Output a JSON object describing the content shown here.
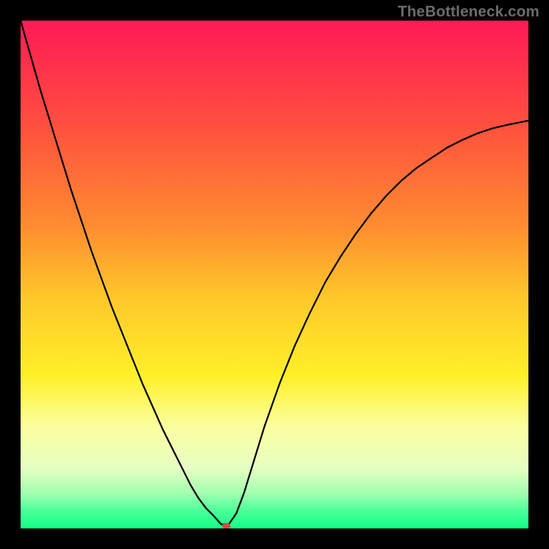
{
  "watermark": "TheBottleneck.com",
  "chart_data": {
    "type": "line",
    "title": "",
    "xlabel": "",
    "ylabel": "",
    "xlim": [
      0,
      100
    ],
    "ylim": [
      0,
      100
    ],
    "grid": false,
    "background": {
      "type": "vertical-gradient",
      "stops": [
        {
          "pos": 0.0,
          "color": "#ff1a55"
        },
        {
          "pos": 0.2,
          "color": "#ff4e3f"
        },
        {
          "pos": 0.4,
          "color": "#ff8b30"
        },
        {
          "pos": 0.55,
          "color": "#ffc92a"
        },
        {
          "pos": 0.7,
          "color": "#fff029"
        },
        {
          "pos": 0.8,
          "color": "#fbffa0"
        },
        {
          "pos": 0.88,
          "color": "#e7ffc2"
        },
        {
          "pos": 0.93,
          "color": "#a4ffb0"
        },
        {
          "pos": 0.965,
          "color": "#4cff9a"
        },
        {
          "pos": 1.0,
          "color": "#12ff86"
        }
      ]
    },
    "series": [
      {
        "name": "bottleneck-curve",
        "color": "#000000",
        "x": [
          0,
          2,
          4,
          6,
          8,
          10,
          12,
          14,
          16,
          18,
          20,
          22,
          24,
          26,
          28,
          30,
          32,
          33.5,
          35,
          36.5,
          38,
          39.5,
          41,
          42.5,
          44,
          46,
          48,
          51,
          54,
          57,
          60,
          63,
          66,
          69,
          72,
          75,
          78,
          81,
          84,
          87,
          90,
          93,
          96,
          100
        ],
        "y": [
          100,
          93,
          86,
          79.5,
          73,
          66.5,
          60.5,
          54.5,
          49,
          43.5,
          38.5,
          33.5,
          28.5,
          24,
          19.5,
          15.5,
          11.5,
          8.5,
          6,
          4,
          2.5,
          0.8,
          0.8,
          3,
          7,
          13.5,
          20,
          28.5,
          36,
          42.5,
          48.5,
          53.5,
          58,
          62,
          65.5,
          68.5,
          71,
          73,
          75,
          76.5,
          77.8,
          78.8,
          79.5,
          80.3
        ]
      }
    ],
    "marker": {
      "name": "optimum-marker",
      "x": 40.5,
      "y": 0.5,
      "color": "#d94b46",
      "rx": 6,
      "ry": 4.5
    }
  }
}
